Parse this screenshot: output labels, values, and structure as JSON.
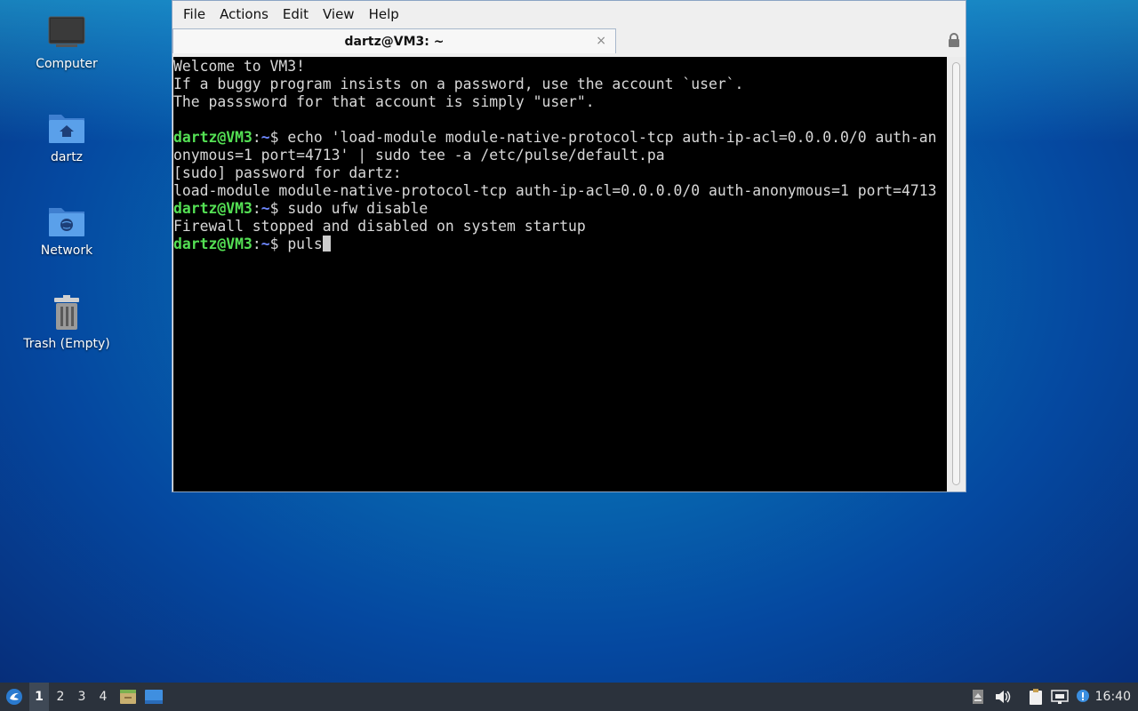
{
  "desktop": {
    "icons": [
      {
        "label": "Computer",
        "icon": "computer-icon"
      },
      {
        "label": "dartz",
        "icon": "home-folder-icon"
      },
      {
        "label": "Network",
        "icon": "network-folder-icon"
      },
      {
        "label": "Trash (Empty)",
        "icon": "trash-icon"
      }
    ]
  },
  "window": {
    "menu": [
      "File",
      "Actions",
      "Edit",
      "View",
      "Help"
    ],
    "tab_title": "dartz@VM3: ~",
    "tab_close": "×"
  },
  "terminal": {
    "prompt": {
      "user": "dartz@VM3",
      "sep": ":",
      "path": "~",
      "symbol": "$ "
    },
    "lines": [
      {
        "text": "Welcome to VM3!"
      },
      {
        "text": "If a buggy program insists on a password, use the account `user`."
      },
      {
        "text": "The passsword for that account is simply \"user\"."
      },
      {
        "text": ""
      },
      {
        "prompt": true,
        "text": "echo 'load-module module-native-protocol-tcp auth-ip-acl=0.0.0.0/0 auth-an"
      },
      {
        "text": "onymous=1 port=4713' | sudo tee -a /etc/pulse/default.pa"
      },
      {
        "text": "[sudo] password for dartz:"
      },
      {
        "text": "load-module module-native-protocol-tcp auth-ip-acl=0.0.0.0/0 auth-anonymous=1 port=4713"
      },
      {
        "prompt": true,
        "text": "sudo ufw disable"
      },
      {
        "text": "Firewall stopped and disabled on system startup"
      },
      {
        "prompt": true,
        "text": "puls",
        "cursor": true
      }
    ]
  },
  "taskbar": {
    "workspaces": [
      "1",
      "2",
      "3",
      "4"
    ],
    "active_workspace": "1",
    "clock": "16:40",
    "tray_icons": [
      "eject-icon",
      "volume-icon",
      "clipboard-icon",
      "network-wired-icon",
      "notification-icon"
    ]
  },
  "colors": {
    "prompt_user": "#54e054",
    "prompt_path": "#6e88ff",
    "terminal_bg": "#000000",
    "taskbar_bg": "#2b323c"
  }
}
